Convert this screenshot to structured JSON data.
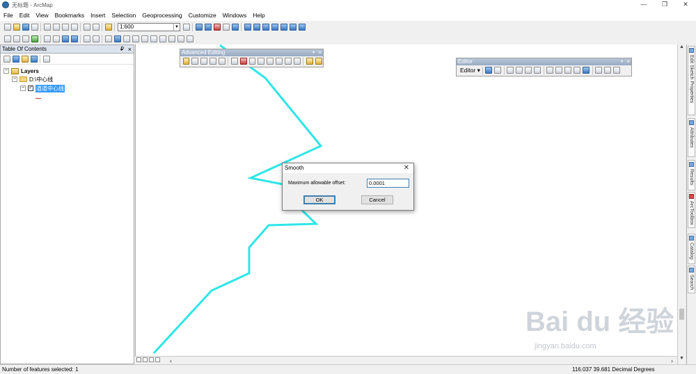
{
  "window": {
    "title": "无标题 - ArcMap",
    "controls": {
      "minimize": "—",
      "maximize": "❐",
      "close": "✕"
    }
  },
  "menubar": {
    "items": [
      "File",
      "Edit",
      "View",
      "Bookmarks",
      "Insert",
      "Selection",
      "Geoprocessing",
      "Customize",
      "Windows",
      "Help"
    ]
  },
  "standard_toolbar": {
    "scale": "1:600"
  },
  "toc": {
    "title": "Table Of Contents",
    "pin": "₽",
    "close": "×",
    "tree": {
      "root_label": "Layers",
      "folder_label": "D:\\中心线",
      "layer_label": "道道中心线",
      "expander_open": "−",
      "checkbox_checked": "✓"
    }
  },
  "advanced_editing": {
    "title": "Advanced Editing",
    "dropdown": "▾",
    "close": "×"
  },
  "editor_toolbar": {
    "title": "Editor",
    "menu_label": "Editor ▾",
    "dropdown": "▾",
    "close": "×"
  },
  "dialog": {
    "title": "Smooth",
    "close": "✕",
    "label": "Maximum allowable offset:",
    "value": "0.0001",
    "ok_label": "OK",
    "cancel_label": "Cancel"
  },
  "right_dock": {
    "tabs": [
      "Edit Sketch Properties",
      "Attributes",
      "Results",
      "ArcToolbox",
      "Catalog",
      "Search"
    ]
  },
  "statusbar": {
    "selected": "Number of features selected: 1",
    "coords": "116.037  39.681 Decimal Degrees"
  },
  "map": {
    "line_color": "#2ee6e6",
    "line_points": [
      [
        220,
        508
      ],
      [
        303,
        418
      ],
      [
        357,
        393
      ],
      [
        357,
        356
      ],
      [
        385,
        324
      ],
      [
        453,
        322
      ],
      [
        418,
        288
      ],
      [
        405,
        265
      ],
      [
        359,
        256
      ],
      [
        460,
        210
      ],
      [
        380,
        112
      ],
      [
        315,
        65
      ]
    ]
  },
  "watermark": {
    "text": "Bai du 经验",
    "sub": "jingyan.baidu.com"
  }
}
